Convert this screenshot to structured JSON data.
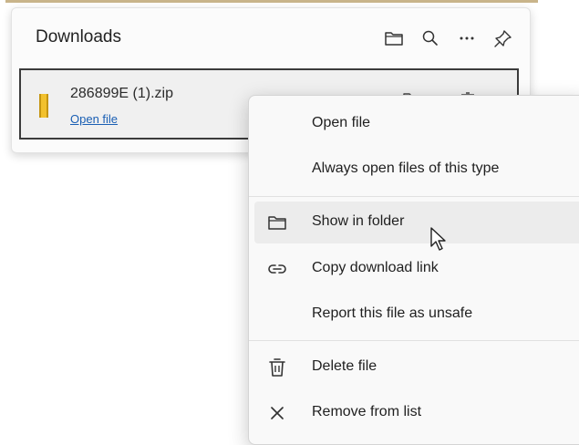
{
  "downloads": {
    "title": "Downloads",
    "header_icons": [
      "folder-icon",
      "search-icon",
      "more-icon",
      "pin-icon"
    ],
    "item": {
      "file_name": "286899E (1).zip",
      "open_link": "Open file",
      "file_icon": "zip-file-icon",
      "action_icons": [
        "folder-icon",
        "delete-icon"
      ]
    }
  },
  "context_menu": {
    "groups": [
      [
        {
          "label": "Open file",
          "icon": ""
        },
        {
          "label": "Always open files of this type",
          "icon": ""
        }
      ],
      [
        {
          "label": "Show in folder",
          "icon": "folder-icon",
          "hovered": true
        },
        {
          "label": "Copy download link",
          "icon": "link-icon"
        },
        {
          "label": "Report this file as unsafe",
          "icon": ""
        }
      ],
      [
        {
          "label": "Delete file",
          "icon": "trash-icon"
        },
        {
          "label": "Remove from list",
          "icon": "close-icon"
        }
      ]
    ]
  },
  "colors": {
    "link": "#1a5fb4",
    "zip_icon": "#f2c12e",
    "menu_hover": "#ececec"
  }
}
